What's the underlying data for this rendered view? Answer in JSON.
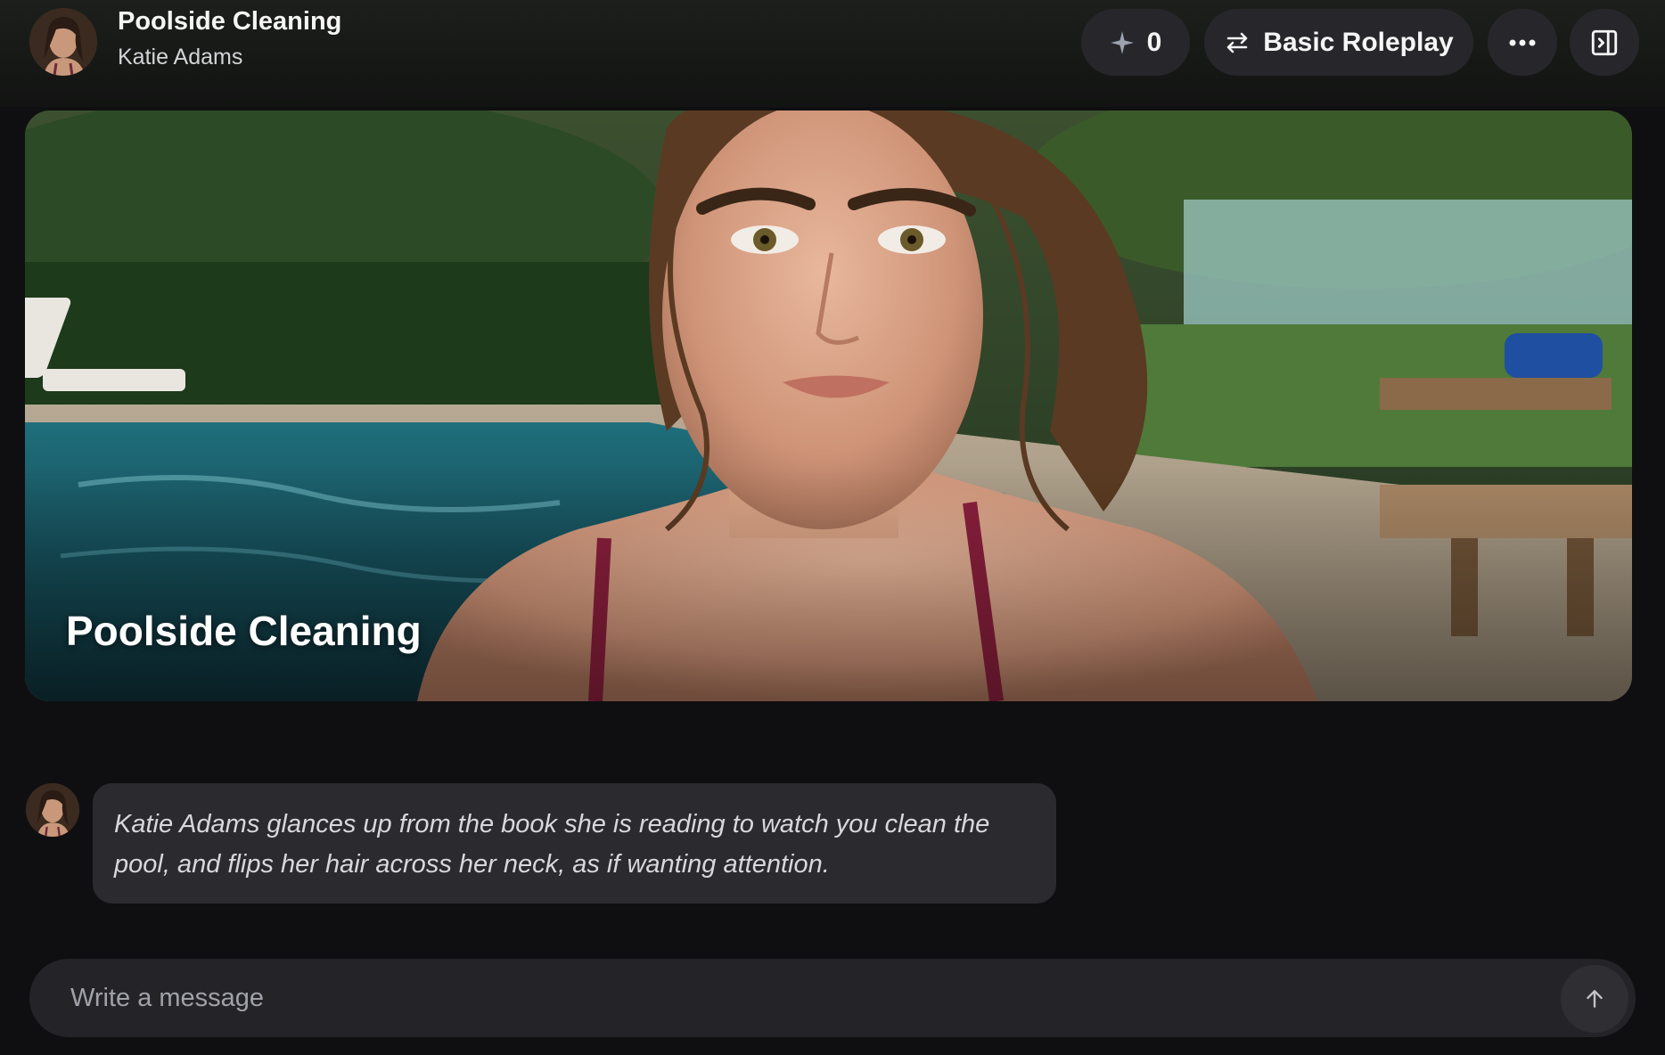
{
  "header": {
    "title": "Poolside Cleaning",
    "subtitle": "Katie Adams",
    "stars_count": "0",
    "mode_label": "Basic Roleplay"
  },
  "hero": {
    "title": "Poolside Cleaning"
  },
  "message": {
    "text": "Katie Adams glances up from the book she is reading to watch you clean the pool, and flips her hair across her neck, as if wanting attention."
  },
  "composer": {
    "placeholder": "Write a message"
  },
  "icons": {
    "stars": "sparkle-icon",
    "mode": "swap-arrows-icon",
    "more": "more-horizontal-icon",
    "panel": "sidebar-toggle-icon",
    "send": "arrow-up-icon"
  },
  "colors": {
    "background": "#0f0f11",
    "pill": "#27272b",
    "bubble": "#2b2b2f",
    "composer": "#242428"
  }
}
